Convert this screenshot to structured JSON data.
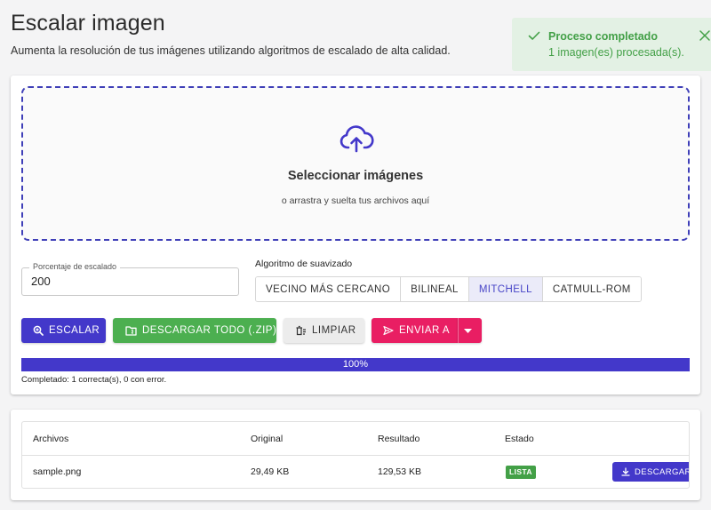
{
  "header": {
    "title": "Escalar imagen",
    "subtitle": "Aumenta la resolución de tus imágenes utilizando algoritmos de escalado de alta calidad."
  },
  "toast": {
    "title": "Proceso completado",
    "message": "1 imagen(es) procesada(s).",
    "color": "#43a047"
  },
  "dropzone": {
    "title": "Seleccionar imágenes",
    "subtitle": "o arrastra y suelta tus archivos aquí"
  },
  "scale": {
    "label": "Porcentaje de escalado",
    "value": "200"
  },
  "algorithm": {
    "label": "Algoritmo de suavizado",
    "options": [
      "VECINO MÁS CERCANO",
      "BILINEAL",
      "MITCHELL",
      "CATMULL-ROM"
    ],
    "selected": "MITCHELL"
  },
  "actions": {
    "escalar": "ESCALAR",
    "download_all": "DESCARGAR TODO (.ZIP)",
    "clear": "LIMPIAR",
    "send_to": "ENVIAR A"
  },
  "progress": {
    "value": 100,
    "label": "100%",
    "status": "Completado: 1 correcta(s), 0 con error."
  },
  "table": {
    "headers": [
      "Archivos",
      "Original",
      "Resultado",
      "Estado"
    ],
    "rows": [
      {
        "file": "sample.png",
        "original": "29,49 KB",
        "result": "129,53 KB",
        "status": "LISTA",
        "action": "DESCARGAR"
      }
    ]
  },
  "colors": {
    "primary": "#4338ca",
    "success": "#4caf50",
    "accent": "#e91e63"
  }
}
